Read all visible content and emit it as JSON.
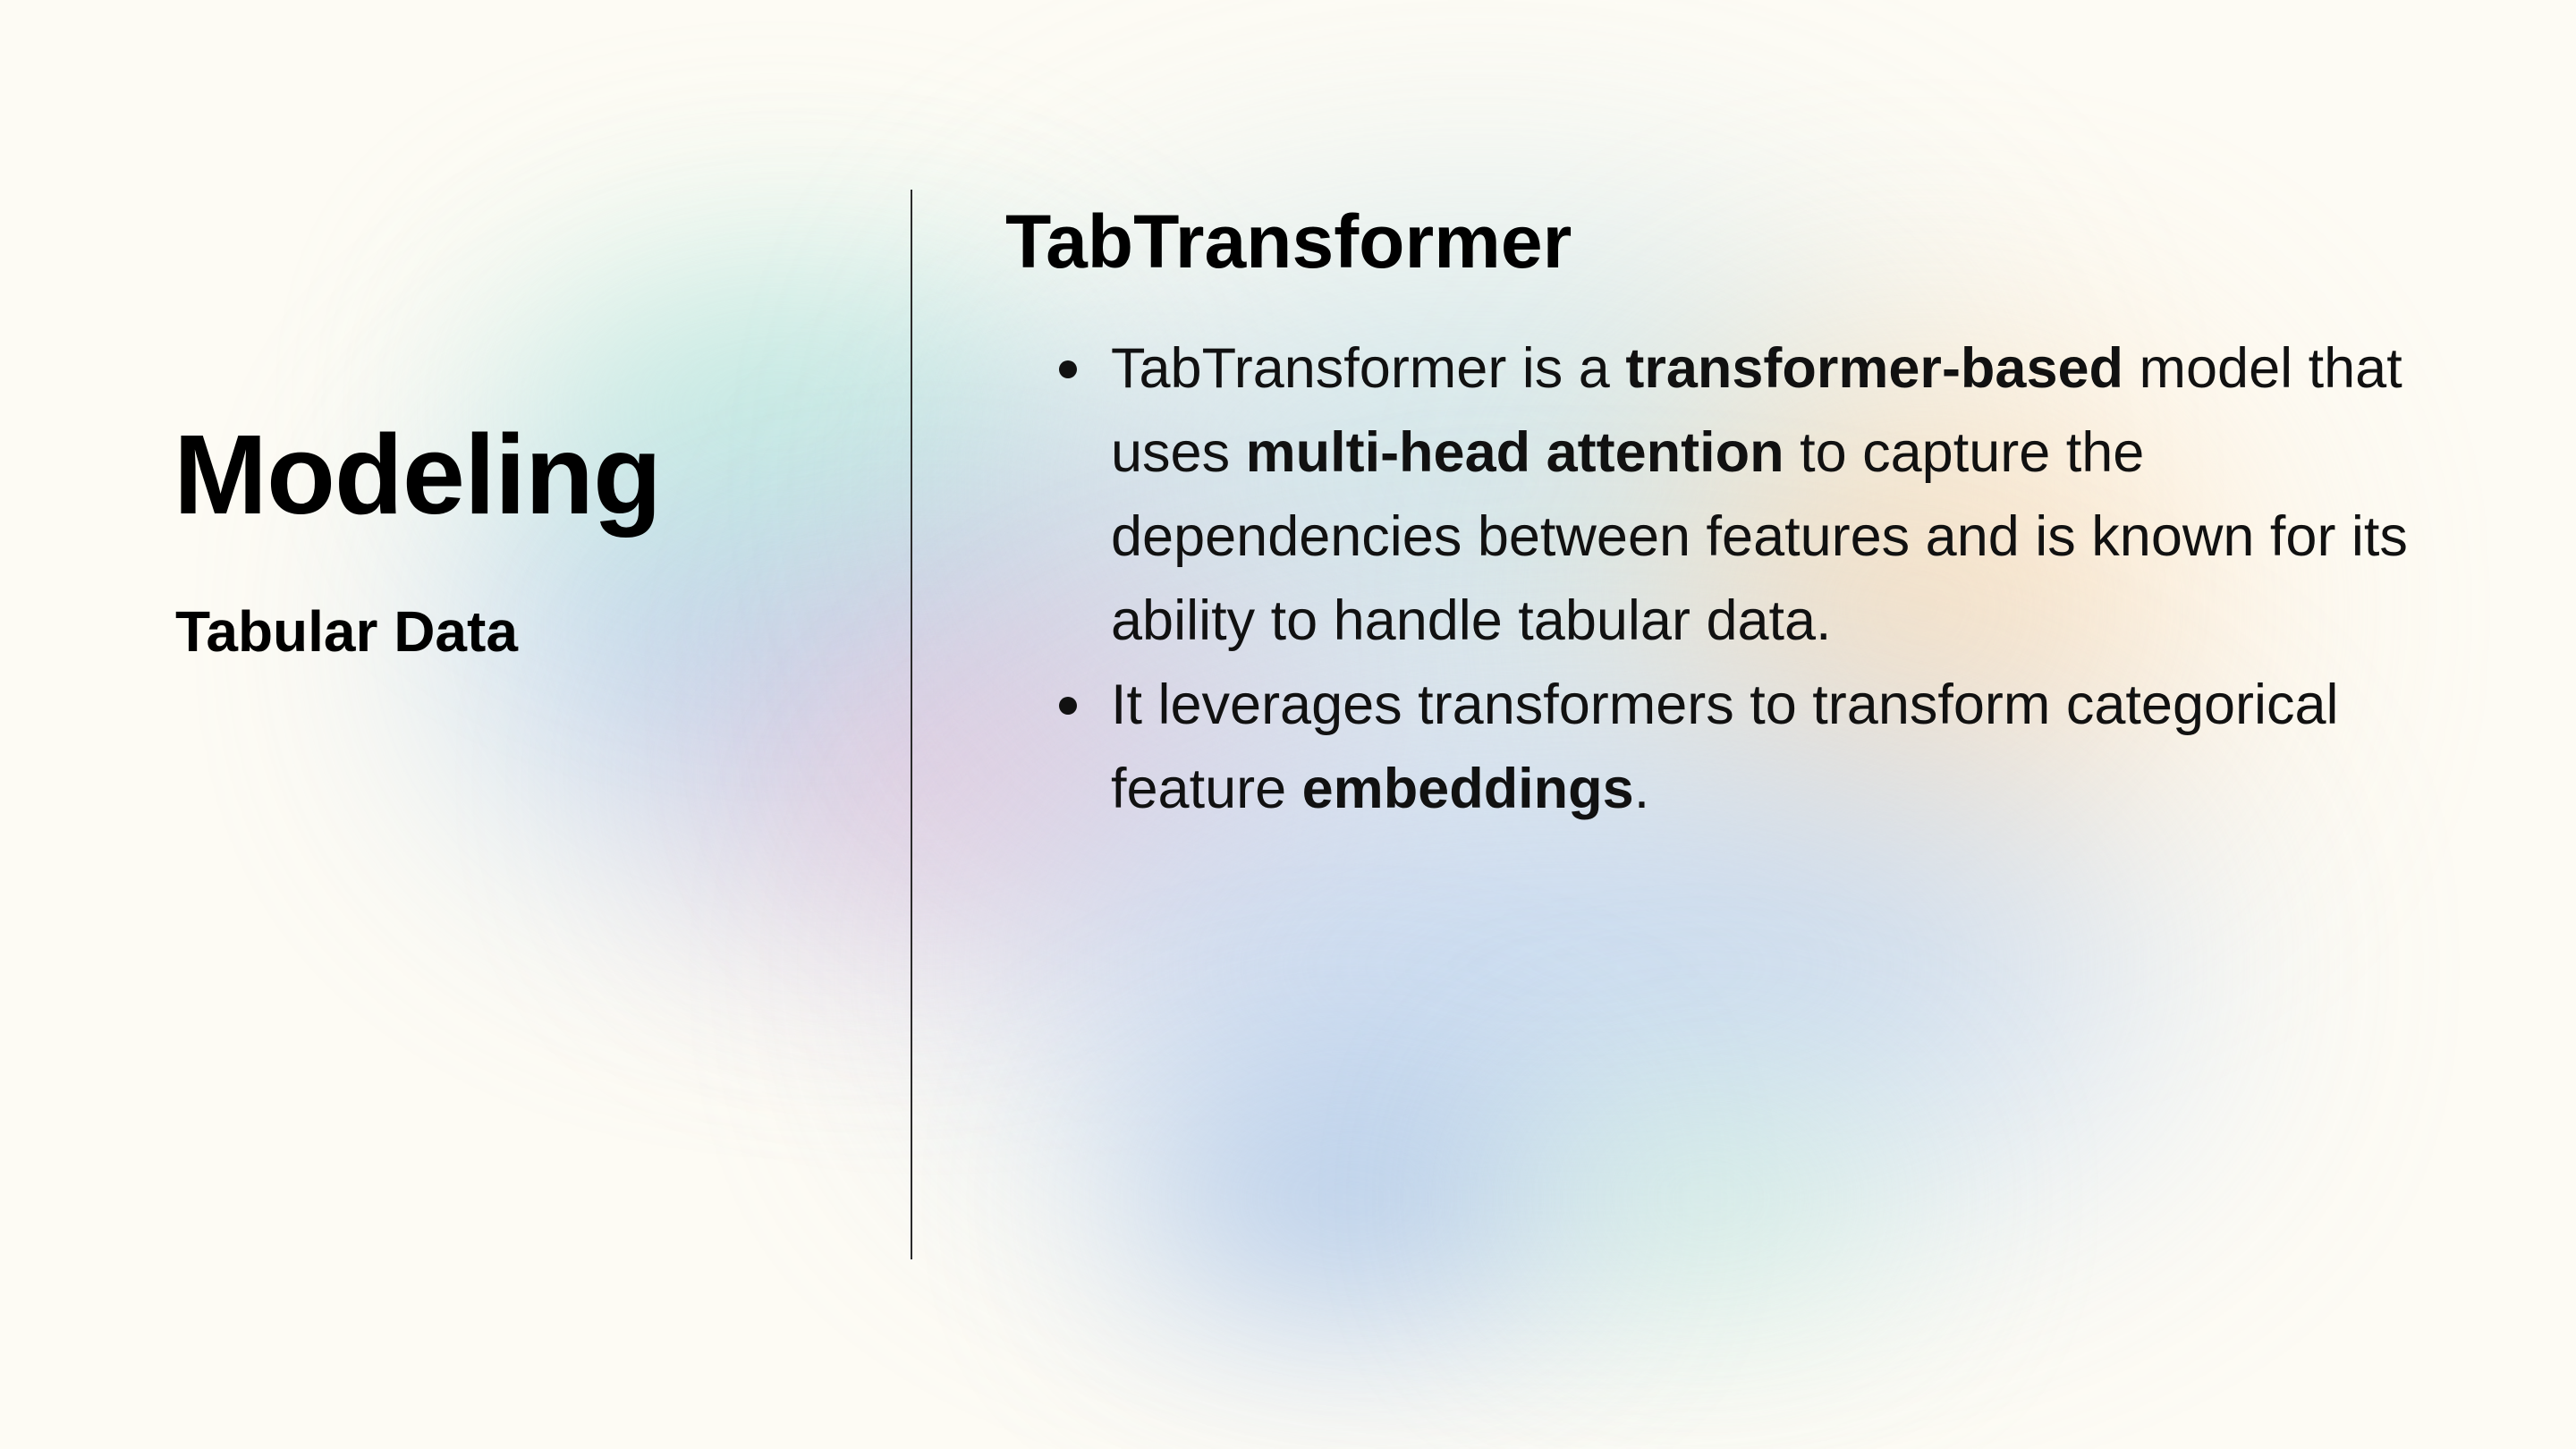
{
  "slide": {
    "title": "Modeling",
    "subtitle": "Tabular Data",
    "section_title": "TabTransformer",
    "bullets": [
      {
        "segments": [
          {
            "text": "TabTransformer is a ",
            "bold": false
          },
          {
            "text": "transformer-based",
            "bold": true
          },
          {
            "text": " model that uses ",
            "bold": false
          },
          {
            "text": "multi-head attention",
            "bold": true
          },
          {
            "text": " to capture the dependencies between features and is known for its ability to handle tabular data.",
            "bold": false
          }
        ]
      },
      {
        "segments": [
          {
            "text": "It leverages transformers to transform categorical feature ",
            "bold": false
          },
          {
            "text": "embeddings",
            "bold": true
          },
          {
            "text": ".",
            "bold": false
          }
        ]
      }
    ]
  },
  "colors": {
    "background": "#fdfbf4",
    "text": "#000000",
    "divider": "#2a2a2a",
    "blob_blue": "#a9c8ea",
    "blob_mint": "#b9ecdb",
    "blob_pink": "#f2c6d8",
    "blob_peach": "#f9d9b4"
  }
}
